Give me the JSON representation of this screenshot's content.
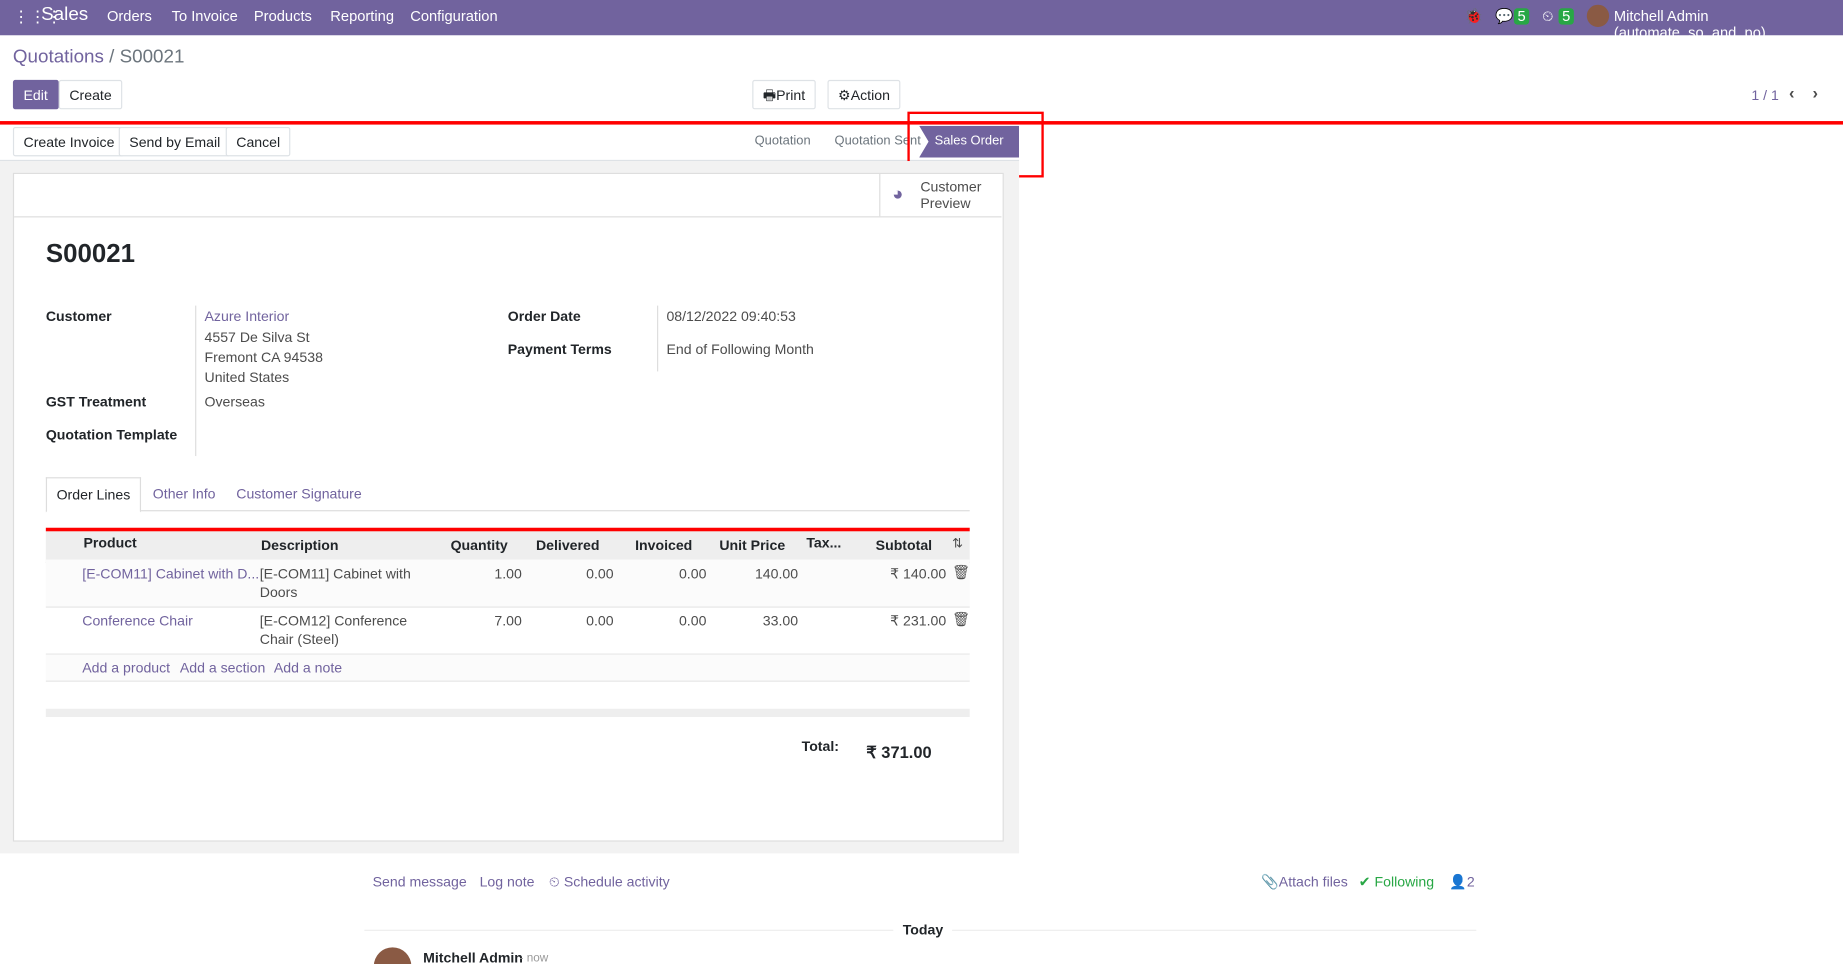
{
  "nav": {
    "app": "Sales",
    "menu": [
      "Orders",
      "To Invoice",
      "Products",
      "Reporting",
      "Configuration"
    ],
    "messages_count": "5",
    "activities_count": "5",
    "user": "Mitchell Admin (automate_so_and_po)"
  },
  "breadcrumb": {
    "parent": "Quotations",
    "current": "S00021"
  },
  "toolbar": {
    "edit": "Edit",
    "create": "Create",
    "print": "Print",
    "action": "Action",
    "pager": "1 / 1"
  },
  "actions": {
    "create_invoice": "Create Invoice",
    "send_email": "Send by Email",
    "cancel": "Cancel"
  },
  "status": {
    "steps": [
      "Quotation",
      "Quotation Sent",
      "Sales Order"
    ],
    "active": "Sales Order"
  },
  "smart_button": {
    "label1": "Customer",
    "label2": "Preview"
  },
  "form": {
    "name": "S00021",
    "customer_label": "Customer",
    "customer": "Azure Interior",
    "address1": "4557 De Silva St",
    "address2": "Fremont CA 94538",
    "address3": "United States",
    "gst_label": "GST Treatment",
    "gst": "Overseas",
    "template_label": "Quotation Template",
    "order_date_label": "Order Date",
    "order_date": "08/12/2022 09:40:53",
    "terms_label": "Payment Terms",
    "terms": "End of Following Month"
  },
  "tabs": [
    "Order Lines",
    "Other Info",
    "Customer Signature"
  ],
  "table": {
    "headers": [
      "Product",
      "Description",
      "Quantity",
      "Delivered",
      "Invoiced",
      "Unit Price",
      "Tax...",
      "Subtotal"
    ],
    "rows": [
      {
        "product": "[E-COM11] Cabinet with D...",
        "desc1": "[E-COM11] Cabinet with",
        "desc2": "Doors",
        "qty": "1.00",
        "delivered": "0.00",
        "invoiced": "0.00",
        "price": "140.00",
        "subtotal": "₹ 140.00"
      },
      {
        "product": "Conference Chair",
        "desc1": "[E-COM12] Conference",
        "desc2": "Chair (Steel)",
        "qty": "7.00",
        "delivered": "0.00",
        "invoiced": "0.00",
        "price": "33.00",
        "subtotal": "₹ 231.00"
      }
    ],
    "add_product": "Add a product",
    "add_section": "Add a section",
    "add_note": "Add a note"
  },
  "total": {
    "label": "Total:",
    "value": "₹ 371.00"
  },
  "chatter": {
    "send": "Send message",
    "log": "Log note",
    "schedule": "Schedule activity",
    "attach": "Attach files",
    "following": "Following",
    "followers": "2",
    "today": "Today",
    "author": "Mitchell Admin",
    "time": "- now"
  }
}
